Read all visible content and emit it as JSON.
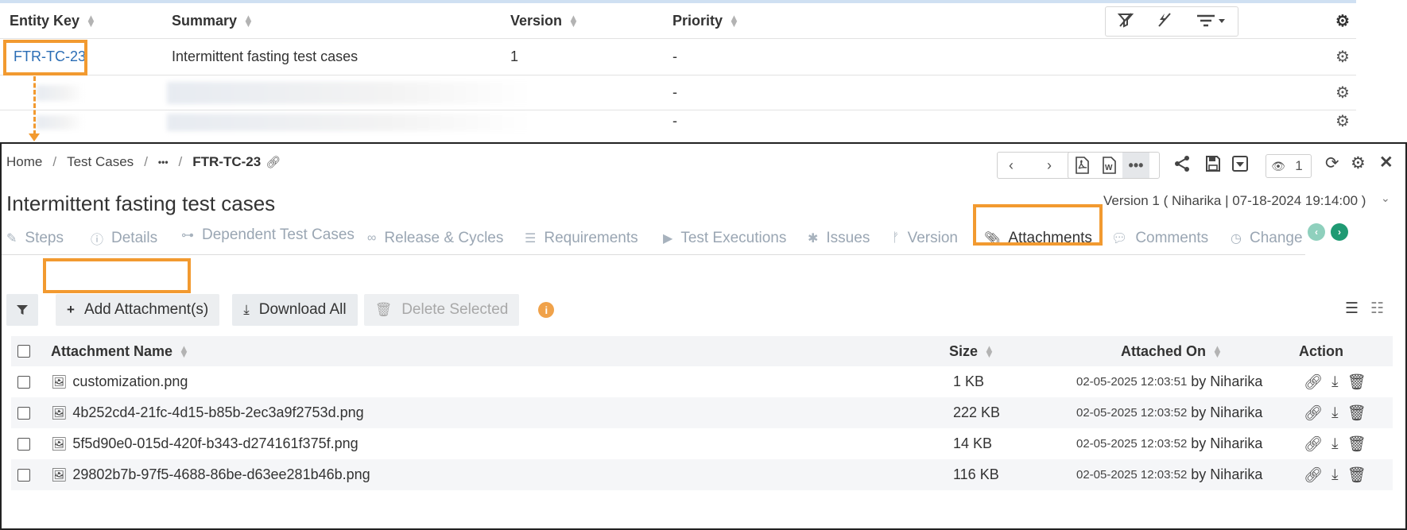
{
  "top_grid": {
    "columns": [
      "Entity Key",
      "Summary",
      "Version",
      "Priority"
    ],
    "rows": [
      {
        "entity_key": "FTR-TC-23",
        "summary": "Intermittent fasting test cases",
        "version": "1",
        "priority": "-"
      },
      {
        "entity_key": "",
        "summary": "",
        "version": "",
        "priority": "-"
      },
      {
        "entity_key": "",
        "summary": "",
        "version": "",
        "priority": "-"
      }
    ]
  },
  "breadcrumb": {
    "home": "Home",
    "section": "Test Cases",
    "ellipsis": "•••",
    "current": "FTR-TC-23"
  },
  "page_title": "Intermittent fasting test cases",
  "version_info": "Version 1 ( Niharika | 07-18-2024 19:14:00 )",
  "watch_count": "1",
  "tabs": [
    {
      "label": "Steps",
      "icon": "edit-icon"
    },
    {
      "label": "Details",
      "icon": "info-icon"
    },
    {
      "label": "Dependent Test Cases",
      "icon": "sitemap-icon"
    },
    {
      "label": "Release & Cycles",
      "icon": "link-icon"
    },
    {
      "label": "Requirements",
      "icon": "list-icon"
    },
    {
      "label": "Test Executions",
      "icon": "play-icon"
    },
    {
      "label": "Issues",
      "icon": "bug-icon"
    },
    {
      "label": "Version",
      "icon": "branch-icon"
    },
    {
      "label": "Attachments",
      "icon": "paperclip-icon",
      "active": true
    },
    {
      "label": "Comments",
      "icon": "comments-icon"
    },
    {
      "label": "Change",
      "icon": "history-icon"
    }
  ],
  "toolbar": {
    "add_label": "Add Attachment(s)",
    "download_label": "Download All",
    "delete_label": "Delete Selected",
    "info_symbol": "i"
  },
  "attachments": {
    "headers": {
      "name": "Attachment Name",
      "size": "Size",
      "attached_on": "Attached On",
      "action": "Action"
    },
    "rows": [
      {
        "name": "customization.png",
        "size": "1 KB",
        "date": "02-05-2025 12:03:51",
        "by": "by Niharika"
      },
      {
        "name": "4b252cd4-21fc-4d15-b85b-2ec3a9f2753d.png",
        "size": "222 KB",
        "date": "02-05-2025 12:03:52",
        "by": "by Niharika"
      },
      {
        "name": "5f5d90e0-015d-420f-b343-d274161f375f.png",
        "size": "14 KB",
        "date": "02-05-2025 12:03:52",
        "by": "by Niharika"
      },
      {
        "name": "29802b7b-97f5-4688-86be-d63ee281b46b.png",
        "size": "116 KB",
        "date": "02-05-2025 12:03:52",
        "by": "by Niharika"
      }
    ]
  },
  "colors": {
    "highlight": "#f29a30",
    "link": "#2a6db5",
    "tab_inactive": "#9aa6b3",
    "scroll_left": "#8fd0bd",
    "scroll_right": "#1f9a73"
  }
}
